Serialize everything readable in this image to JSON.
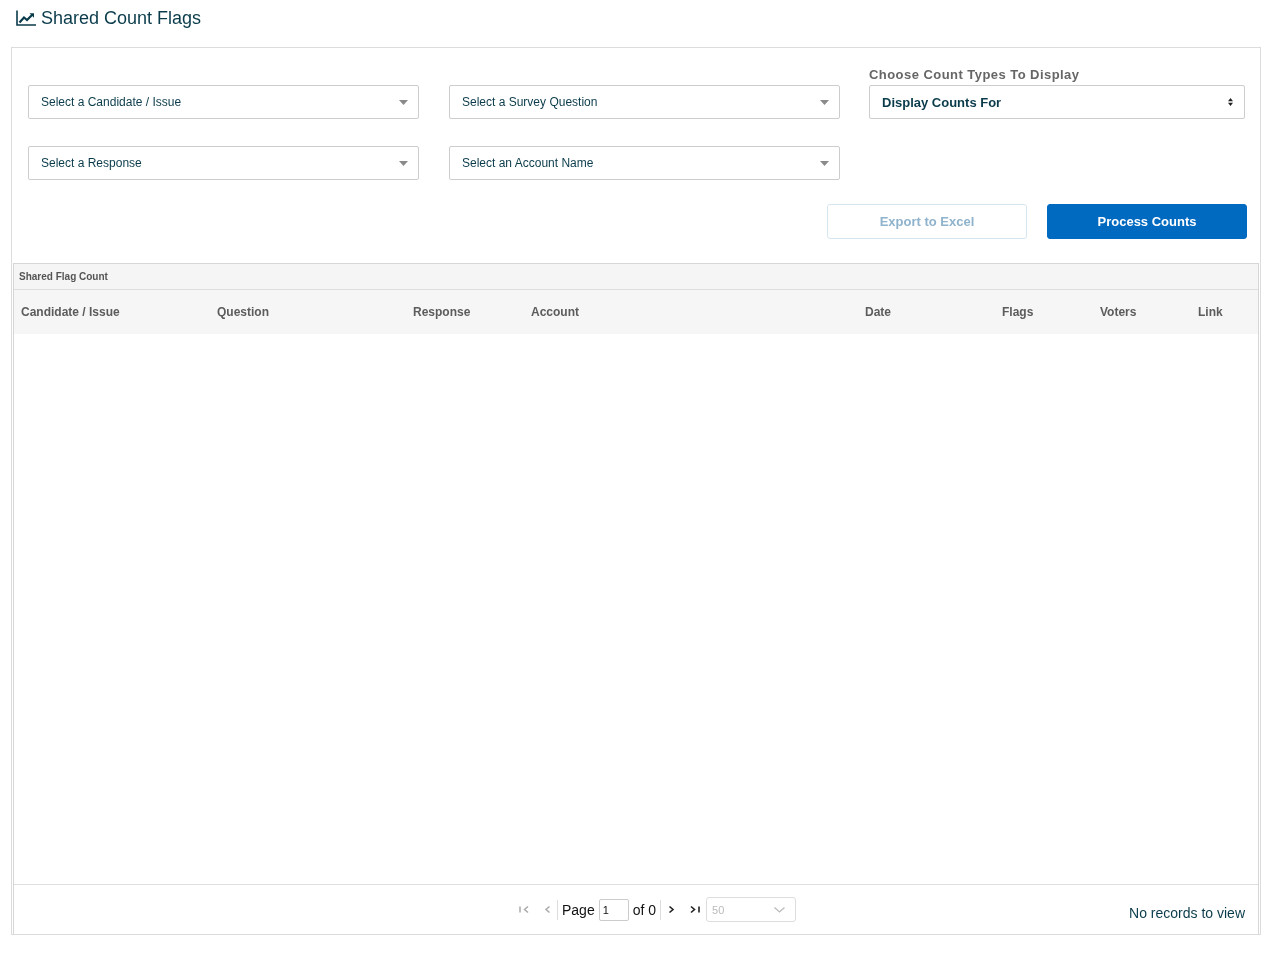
{
  "page": {
    "title": "Shared Count Flags"
  },
  "filters": [
    {
      "placeholder": "Select a Candidate / Issue"
    },
    {
      "placeholder": "Select a Survey Question"
    },
    {
      "placeholder": "Select a Response"
    },
    {
      "placeholder": "Select an Account Name"
    }
  ],
  "count_types": {
    "label": "Choose Count Types To Display",
    "value": "Display Counts For"
  },
  "buttons": [
    {
      "label": "Export to Excel",
      "disabled": true
    },
    {
      "label": "Process Counts",
      "disabled": false
    }
  ],
  "grid": {
    "caption": "Shared Flag Count",
    "columns": [
      "Candidate / Issue",
      "Question",
      "Response",
      "Account",
      "Date",
      "Flags",
      "Voters",
      "Link"
    ]
  },
  "pager": {
    "nav_back": [
      {
        "kind": "first",
        "disabled": true
      },
      {
        "kind": "prev",
        "disabled": true
      }
    ],
    "page_label": "Page",
    "page": "1",
    "of_label": "of 0",
    "nav_forward": [
      {
        "kind": "next",
        "disabled": false
      },
      {
        "kind": "last",
        "disabled": false
      }
    ],
    "page_size": {
      "value": "50",
      "disabled": true
    },
    "status": "No records to view"
  }
}
